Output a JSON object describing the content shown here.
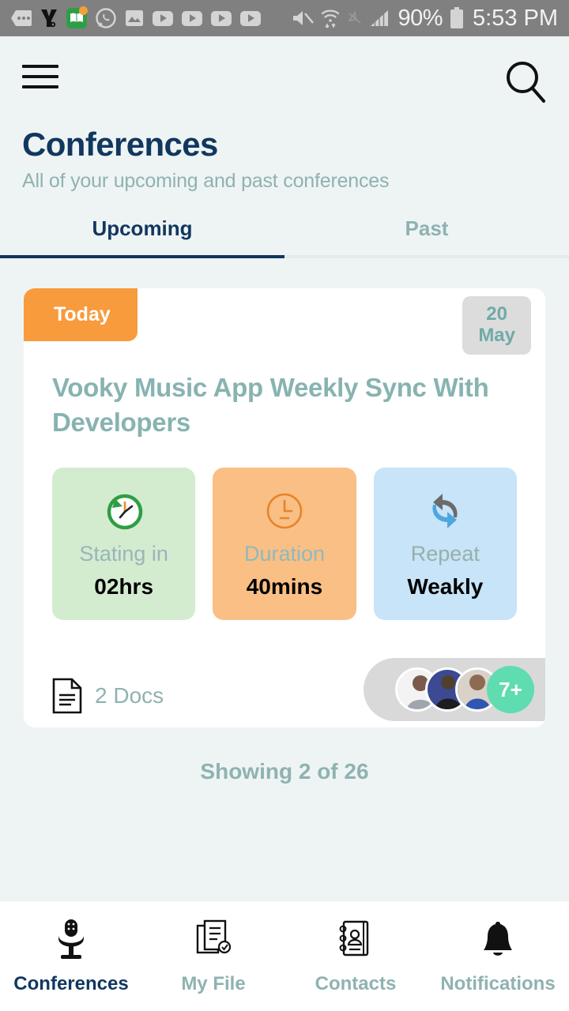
{
  "status_bar": {
    "notification_icons": [
      "message-icon",
      "yandex-icon",
      "book-app-icon",
      "whatsapp-icon",
      "gallery-icon",
      "youtube-icon",
      "youtube-icon",
      "youtube-icon",
      "youtube-icon"
    ],
    "system_icons": [
      "mute-icon",
      "wifi-icon",
      "location-off-icon",
      "signal-icon"
    ],
    "battery_percent": "90%",
    "time": "5:53 PM",
    "background": "#808080"
  },
  "header": {
    "menu_icon": "hamburger-menu-icon",
    "search_icon": "search-icon",
    "title": "Conferences",
    "subtitle": "All of your upcoming and past conferences",
    "title_color": "#11375f",
    "subtitle_color": "#8fb2b1"
  },
  "tabs": {
    "items": [
      {
        "label": "Upcoming",
        "active": true
      },
      {
        "label": "Past",
        "active": false
      }
    ]
  },
  "conference_card": {
    "today_badge": "Today",
    "date_badge": {
      "day": "20",
      "month": "May"
    },
    "title": "Vooky Music App Weekly Sync With Developers",
    "stats": [
      {
        "icon": "clock-restore-icon",
        "label": "Stating in",
        "value": "02hrs",
        "color": "#d3ecd0"
      },
      {
        "icon": "clock-icon",
        "label": "Duration",
        "value": "40mins",
        "color": "#f9bf85"
      },
      {
        "icon": "repeat-arrows-icon",
        "label": "Repeat",
        "value": "Weakly",
        "color": "#c7e4f8"
      }
    ],
    "docs": {
      "icon": "document-icon",
      "label": "2 Docs"
    },
    "attendees": {
      "avatar_count": 3,
      "overflow_label": "7+",
      "overflow_color": "#5fdcb0"
    }
  },
  "footer_status": "Showing 2 of 26",
  "bottom_nav": {
    "items": [
      {
        "icon": "microphone-icon",
        "label": "Conferences",
        "active": true
      },
      {
        "icon": "files-check-icon",
        "label": "My File",
        "active": false
      },
      {
        "icon": "contact-book-icon",
        "label": "Contacts",
        "active": false
      },
      {
        "icon": "bell-icon",
        "label": "Notifications",
        "active": false
      }
    ]
  }
}
